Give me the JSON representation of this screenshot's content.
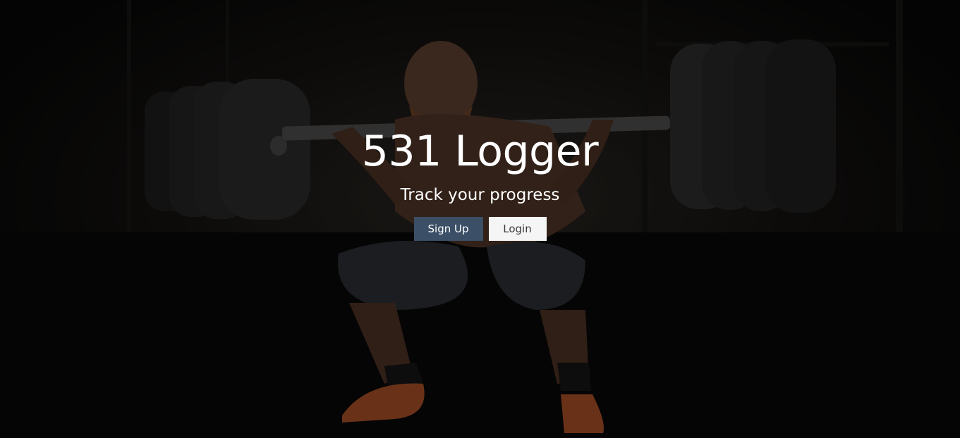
{
  "hero": {
    "title": "531 Logger",
    "subtitle": "Track your progress",
    "background_image": "athlete-squatting-barbell-image"
  },
  "buttons": {
    "signup_label": "Sign Up",
    "login_label": "Login"
  },
  "colors": {
    "signup_bg": "#3b4f66",
    "login_bg": "#f5f5f5",
    "title_text": "#ffffff"
  }
}
